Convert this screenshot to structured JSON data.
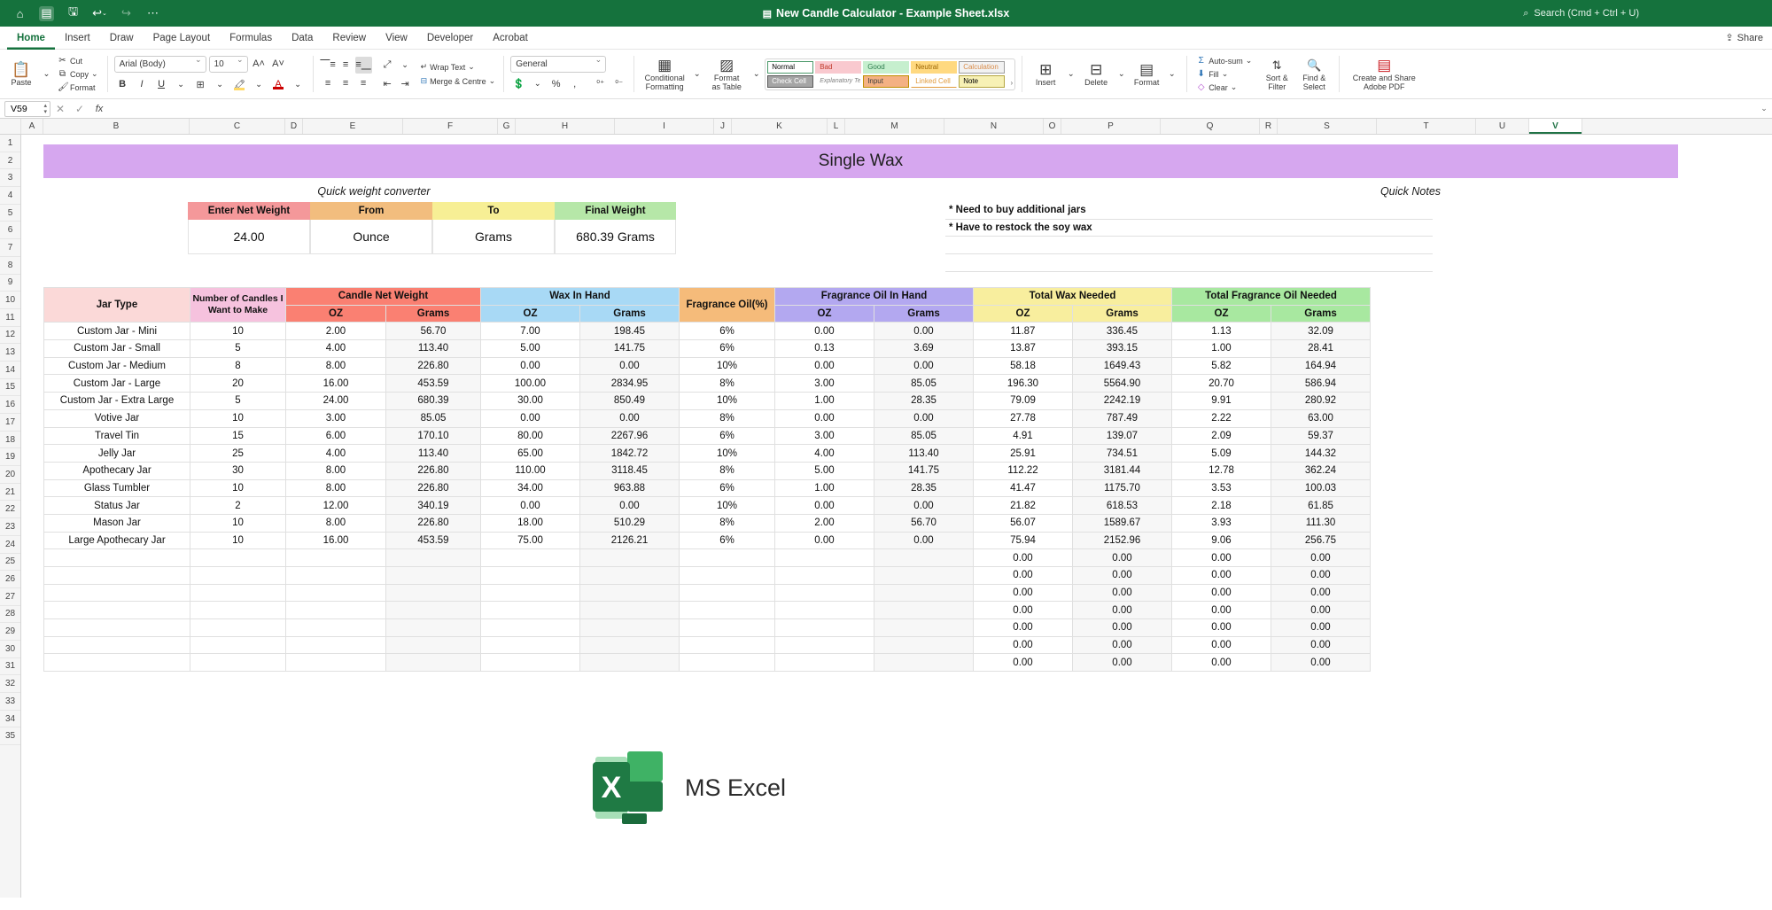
{
  "titlebar": {
    "filename": "New Candle Calculator - Example Sheet.xlsx",
    "search_placeholder": "Search (Cmd + Ctrl + U)",
    "icons": [
      "home-icon",
      "save-icon",
      "save-as-icon",
      "undo-icon",
      "redo-icon",
      "more-icon"
    ]
  },
  "tabs": [
    {
      "label": "Home",
      "selected": true
    },
    {
      "label": "Insert",
      "selected": false
    },
    {
      "label": "Draw",
      "selected": false
    },
    {
      "label": "Page Layout",
      "selected": false
    },
    {
      "label": "Formulas",
      "selected": false
    },
    {
      "label": "Data",
      "selected": false
    },
    {
      "label": "Review",
      "selected": false
    },
    {
      "label": "View",
      "selected": false
    },
    {
      "label": "Developer",
      "selected": false
    },
    {
      "label": "Acrobat",
      "selected": false
    }
  ],
  "share_label": "Share",
  "ribbon": {
    "paste_label": "Paste",
    "cut_label": "Cut",
    "copy_label": "Copy",
    "format_painter_label": "Format",
    "font_name": "Arial (Body)",
    "font_size": "10",
    "wrap_text_label": "Wrap Text",
    "merge_label": "Merge & Centre",
    "number_format": "General",
    "conditional_formatting_label": "Conditional Formatting",
    "format_as_table_label": "Format as Table",
    "insert_label": "Insert",
    "delete_label": "Delete",
    "format_label": "Format",
    "autosum_label": "Auto-sum",
    "fill_label": "Fill",
    "clear_label": "Clear",
    "sort_filter_label": "Sort & Filter",
    "find_select_label": "Find & Select",
    "adobe_label": "Create and Share Adobe PDF",
    "cell_styles": [
      [
        {
          "name": "Normal",
          "bg": "#ffffff",
          "fg": "#000000",
          "border": "#4c9a6b"
        },
        {
          "name": "Bad",
          "bg": "#f9c9cf",
          "fg": "#c0392b",
          "border": "#f9c9cf"
        },
        {
          "name": "Good",
          "bg": "#c6efce",
          "fg": "#2e7d4f",
          "border": "#c6efce"
        },
        {
          "name": "Neutral",
          "bg": "#ffd980",
          "fg": "#9c6500",
          "border": "#ffd980"
        },
        {
          "name": "Calculation",
          "bg": "#f2f2f2",
          "fg": "#d98c4a",
          "border": "#9e9e9e"
        }
      ],
      [
        {
          "name": "Check Cell",
          "bg": "#a5a5a5",
          "fg": "#ffffff",
          "border": "#5a5a5a"
        },
        {
          "name": "Explanatory Text",
          "bg": "#ffffff",
          "fg": "#7f7f7f",
          "border": "#ffffff"
        },
        {
          "name": "Input",
          "bg": "#f4b183",
          "fg": "#3f3f3f",
          "border": "#bf8f00"
        },
        {
          "name": "Linked Cell",
          "bg": "#ffffff",
          "fg": "#e09b3d",
          "border": "#e09b3d"
        },
        {
          "name": "Note",
          "bg": "#f7f1b5",
          "fg": "#000000",
          "border": "#b5a642"
        }
      ]
    ]
  },
  "formula_bar": {
    "name_box": "V59",
    "formula": ""
  },
  "grid": {
    "columns": [
      "A",
      "B",
      "C",
      "D",
      "E",
      "F",
      "G",
      "H",
      "I",
      "J",
      "K",
      "L",
      "M",
      "N",
      "O",
      "P",
      "Q",
      "R",
      "S",
      "T",
      "U",
      "V"
    ],
    "active_column": "V",
    "row_count": 35
  },
  "sheet": {
    "banner_title": "Single Wax",
    "converter_caption": "Quick weight converter",
    "converter": {
      "headers": [
        "Enter Net Weight",
        "From",
        "To",
        "Final Weight"
      ],
      "header_colors": [
        "#f4989a",
        "#f2bd7e",
        "#f7ef95",
        "#b6e7a8"
      ],
      "values": [
        "24.00",
        "Ounce",
        "Grams",
        "680.39 Grams"
      ]
    },
    "notes_caption": "Quick Notes",
    "notes": [
      "* Need to buy additional jars",
      "* Have to restock the soy wax",
      "",
      ""
    ],
    "table": {
      "groups": [
        {
          "label": "Jar Type",
          "color": "#fbd9d8",
          "span": 1
        },
        {
          "label": "Number of Candles I Want to Make",
          "color": "#f6c2de",
          "span": 1
        },
        {
          "label": "Candle Net Weight",
          "color": "#fa8072",
          "span": 2
        },
        {
          "label": "Wax In Hand",
          "color": "#a8d9f5",
          "span": 2
        },
        {
          "label": "Fragrance Oil(%)",
          "color": "#f5bb7a",
          "span": 1
        },
        {
          "label": "Fragrance Oil In Hand",
          "color": "#b3a8f0",
          "span": 2
        },
        {
          "label": "Total Wax Needed",
          "color": "#f8ee9e",
          "span": 2
        },
        {
          "label": "Total Fragrance Oil Needed",
          "color": "#a8e8a0",
          "span": 2
        }
      ],
      "subheaders": [
        "",
        "",
        "OZ",
        "Grams",
        "OZ",
        "Grams",
        "",
        "OZ",
        "Grams",
        "OZ",
        "Grams"
      ],
      "rows": [
        {
          "jar": "Custom Jar - Mini",
          "qty": "10",
          "net_oz": "2.00",
          "net_g": "56.70",
          "wax_oz": "7.00",
          "wax_g": "198.45",
          "fo_pct": "6%",
          "foh_oz": "0.00",
          "foh_g": "0.00",
          "twax_oz": "11.87",
          "twax_g": "336.45",
          "tfo_oz": "1.13",
          "tfo_g": "32.09"
        },
        {
          "jar": "Custom Jar - Small",
          "qty": "5",
          "net_oz": "4.00",
          "net_g": "113.40",
          "wax_oz": "5.00",
          "wax_g": "141.75",
          "fo_pct": "6%",
          "foh_oz": "0.13",
          "foh_g": "3.69",
          "twax_oz": "13.87",
          "twax_g": "393.15",
          "tfo_oz": "1.00",
          "tfo_g": "28.41"
        },
        {
          "jar": "Custom Jar - Medium",
          "qty": "8",
          "net_oz": "8.00",
          "net_g": "226.80",
          "wax_oz": "0.00",
          "wax_g": "0.00",
          "fo_pct": "10%",
          "foh_oz": "0.00",
          "foh_g": "0.00",
          "twax_oz": "58.18",
          "twax_g": "1649.43",
          "tfo_oz": "5.82",
          "tfo_g": "164.94"
        },
        {
          "jar": "Custom Jar - Large",
          "qty": "20",
          "net_oz": "16.00",
          "net_g": "453.59",
          "wax_oz": "100.00",
          "wax_g": "2834.95",
          "fo_pct": "8%",
          "foh_oz": "3.00",
          "foh_g": "85.05",
          "twax_oz": "196.30",
          "twax_g": "5564.90",
          "tfo_oz": "20.70",
          "tfo_g": "586.94"
        },
        {
          "jar": "Custom Jar - Extra Large",
          "qty": "5",
          "net_oz": "24.00",
          "net_g": "680.39",
          "wax_oz": "30.00",
          "wax_g": "850.49",
          "fo_pct": "10%",
          "foh_oz": "1.00",
          "foh_g": "28.35",
          "twax_oz": "79.09",
          "twax_g": "2242.19",
          "tfo_oz": "9.91",
          "tfo_g": "280.92"
        },
        {
          "jar": "Votive Jar",
          "qty": "10",
          "net_oz": "3.00",
          "net_g": "85.05",
          "wax_oz": "0.00",
          "wax_g": "0.00",
          "fo_pct": "8%",
          "foh_oz": "0.00",
          "foh_g": "0.00",
          "twax_oz": "27.78",
          "twax_g": "787.49",
          "tfo_oz": "2.22",
          "tfo_g": "63.00"
        },
        {
          "jar": "Travel Tin",
          "qty": "15",
          "net_oz": "6.00",
          "net_g": "170.10",
          "wax_oz": "80.00",
          "wax_g": "2267.96",
          "fo_pct": "6%",
          "foh_oz": "3.00",
          "foh_g": "85.05",
          "twax_oz": "4.91",
          "twax_g": "139.07",
          "tfo_oz": "2.09",
          "tfo_g": "59.37"
        },
        {
          "jar": "Jelly Jar",
          "qty": "25",
          "net_oz": "4.00",
          "net_g": "113.40",
          "wax_oz": "65.00",
          "wax_g": "1842.72",
          "fo_pct": "10%",
          "foh_oz": "4.00",
          "foh_g": "113.40",
          "twax_oz": "25.91",
          "twax_g": "734.51",
          "tfo_oz": "5.09",
          "tfo_g": "144.32"
        },
        {
          "jar": "Apothecary Jar",
          "qty": "30",
          "net_oz": "8.00",
          "net_g": "226.80",
          "wax_oz": "110.00",
          "wax_g": "3118.45",
          "fo_pct": "8%",
          "foh_oz": "5.00",
          "foh_g": "141.75",
          "twax_oz": "112.22",
          "twax_g": "3181.44",
          "tfo_oz": "12.78",
          "tfo_g": "362.24"
        },
        {
          "jar": "Glass Tumbler",
          "qty": "10",
          "net_oz": "8.00",
          "net_g": "226.80",
          "wax_oz": "34.00",
          "wax_g": "963.88",
          "fo_pct": "6%",
          "foh_oz": "1.00",
          "foh_g": "28.35",
          "twax_oz": "41.47",
          "twax_g": "1175.70",
          "tfo_oz": "3.53",
          "tfo_g": "100.03"
        },
        {
          "jar": "Status Jar",
          "qty": "2",
          "net_oz": "12.00",
          "net_g": "340.19",
          "wax_oz": "0.00",
          "wax_g": "0.00",
          "fo_pct": "10%",
          "foh_oz": "0.00",
          "foh_g": "0.00",
          "twax_oz": "21.82",
          "twax_g": "618.53",
          "tfo_oz": "2.18",
          "tfo_g": "61.85"
        },
        {
          "jar": "Mason Jar",
          "qty": "10",
          "net_oz": "8.00",
          "net_g": "226.80",
          "wax_oz": "18.00",
          "wax_g": "510.29",
          "fo_pct": "8%",
          "foh_oz": "2.00",
          "foh_g": "56.70",
          "twax_oz": "56.07",
          "twax_g": "1589.67",
          "tfo_oz": "3.93",
          "tfo_g": "111.30"
        },
        {
          "jar": "Large Apothecary Jar",
          "qty": "10",
          "net_oz": "16.00",
          "net_g": "453.59",
          "wax_oz": "75.00",
          "wax_g": "2126.21",
          "fo_pct": "6%",
          "foh_oz": "0.00",
          "foh_g": "0.00",
          "twax_oz": "75.94",
          "twax_g": "2152.96",
          "tfo_oz": "9.06",
          "tfo_g": "256.75"
        },
        {
          "jar": "",
          "qty": "",
          "net_oz": "",
          "net_g": "",
          "wax_oz": "",
          "wax_g": "",
          "fo_pct": "",
          "foh_oz": "",
          "foh_g": "",
          "twax_oz": "0.00",
          "twax_g": "0.00",
          "tfo_oz": "0.00",
          "tfo_g": "0.00"
        },
        {
          "jar": "",
          "qty": "",
          "net_oz": "",
          "net_g": "",
          "wax_oz": "",
          "wax_g": "",
          "fo_pct": "",
          "foh_oz": "",
          "foh_g": "",
          "twax_oz": "0.00",
          "twax_g": "0.00",
          "tfo_oz": "0.00",
          "tfo_g": "0.00"
        },
        {
          "jar": "",
          "qty": "",
          "net_oz": "",
          "net_g": "",
          "wax_oz": "",
          "wax_g": "",
          "fo_pct": "",
          "foh_oz": "",
          "foh_g": "",
          "twax_oz": "0.00",
          "twax_g": "0.00",
          "tfo_oz": "0.00",
          "tfo_g": "0.00"
        },
        {
          "jar": "",
          "qty": "",
          "net_oz": "",
          "net_g": "",
          "wax_oz": "",
          "wax_g": "",
          "fo_pct": "",
          "foh_oz": "",
          "foh_g": "",
          "twax_oz": "0.00",
          "twax_g": "0.00",
          "tfo_oz": "0.00",
          "tfo_g": "0.00"
        },
        {
          "jar": "",
          "qty": "",
          "net_oz": "",
          "net_g": "",
          "wax_oz": "",
          "wax_g": "",
          "fo_pct": "",
          "foh_oz": "",
          "foh_g": "",
          "twax_oz": "0.00",
          "twax_g": "0.00",
          "tfo_oz": "0.00",
          "tfo_g": "0.00"
        },
        {
          "jar": "",
          "qty": "",
          "net_oz": "",
          "net_g": "",
          "wax_oz": "",
          "wax_g": "",
          "fo_pct": "",
          "foh_oz": "",
          "foh_g": "",
          "twax_oz": "0.00",
          "twax_g": "0.00",
          "tfo_oz": "0.00",
          "tfo_g": "0.00"
        },
        {
          "jar": "",
          "qty": "",
          "net_oz": "",
          "net_g": "",
          "wax_oz": "",
          "wax_g": "",
          "fo_pct": "",
          "foh_oz": "",
          "foh_g": "",
          "twax_oz": "0.00",
          "twax_g": "0.00",
          "tfo_oz": "0.00",
          "tfo_g": "0.00"
        }
      ]
    },
    "watermark": {
      "label": "MS Excel",
      "letter": "X"
    }
  }
}
